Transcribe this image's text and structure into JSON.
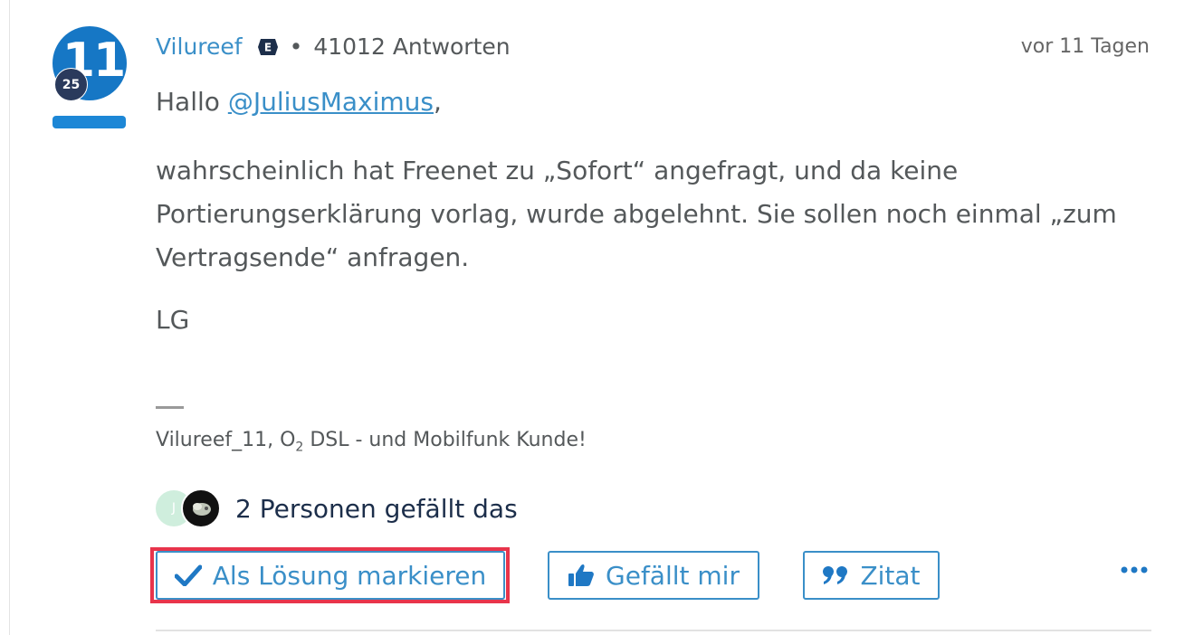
{
  "post": {
    "avatar_initials": "11",
    "rank_number": "25",
    "author": "Vilureef",
    "expert_badge": "E",
    "separator": "•",
    "replies": "41012 Antworten",
    "time": "vor 11 Tagen",
    "greeting_prefix": "Hallo ",
    "mention": "@JuliusMaximus",
    "greeting_suffix": ",",
    "body": "wahrscheinlich hat Freenet zu „Sofort“ angefragt, und da keine Portierungserklärung vorlag, wurde abgelehnt. Sie sollen noch einmal „zum Vertragsende“ anfragen.",
    "signoff": "LG",
    "signature": {
      "prefix": "Vilureef_11, O",
      "sub": "2",
      "suffix": " DSL - und Mobilfunk Kunde!"
    }
  },
  "likes": {
    "avatar1_initial": "J",
    "text": "2 Personen gefällt das"
  },
  "actions": {
    "solution_label": "Als Lösung markieren",
    "like_label": "Gefällt mir",
    "quote_label": "Zitat"
  },
  "colors": {
    "link": "#3a8fc8",
    "avatar": "#1677c5",
    "highlight": "#e8344b",
    "rank_badge": "#2a3a5c"
  },
  "icons": [
    "expert-badge-icon",
    "checkmark-icon",
    "thumbs-up-icon",
    "quote-icon",
    "more-options-icon"
  ]
}
